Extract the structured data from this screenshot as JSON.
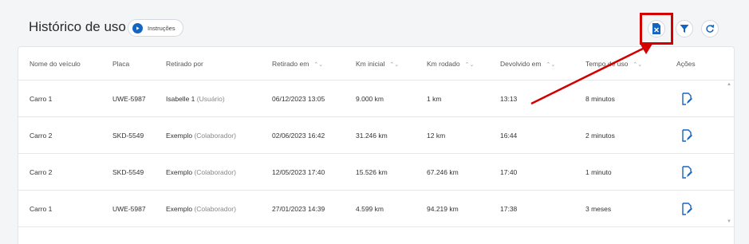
{
  "header": {
    "title": "Histórico de uso",
    "instructions_label": "Instruções"
  },
  "toolbar": {
    "export_icon": "spreadsheet-export-icon",
    "filter_icon": "filter-icon",
    "refresh_icon": "refresh-icon"
  },
  "table": {
    "columns": [
      {
        "label": "Nome do veículo",
        "sortable": false
      },
      {
        "label": "Placa",
        "sortable": false
      },
      {
        "label": "Retirado por",
        "sortable": false
      },
      {
        "label": "Retirado em",
        "sortable": true
      },
      {
        "label": "Km inicial",
        "sortable": true
      },
      {
        "label": "Km rodado",
        "sortable": true
      },
      {
        "label": "Devolvido em",
        "sortable": true
      },
      {
        "label": "Tempo de uso",
        "sortable": true
      },
      {
        "label": "Ações",
        "sortable": false
      }
    ],
    "rows": [
      {
        "vehicle": "Carro 1",
        "plate": "UWE-5987",
        "user": "Isabelle 1",
        "role": "(Usuário)",
        "taken_at": "06/12/2023 13:05",
        "km_start": "9.000 km",
        "km_driven": "1 km",
        "returned_at": "13:13",
        "duration": "8 minutos"
      },
      {
        "vehicle": "Carro 2",
        "plate": "SKD-5549",
        "user": "Exemplo",
        "role": "(Colaborador)",
        "taken_at": "02/06/2023 16:42",
        "km_start": "31.246 km",
        "km_driven": "12 km",
        "returned_at": "16:44",
        "duration": "2 minutos"
      },
      {
        "vehicle": "Carro 2",
        "plate": "SKD-5549",
        "user": "Exemplo",
        "role": "(Colaborador)",
        "taken_at": "12/05/2023 17:40",
        "km_start": "15.526 km",
        "km_driven": "67.246 km",
        "returned_at": "17:40",
        "duration": "1 minuto"
      },
      {
        "vehicle": "Carro 1",
        "plate": "UWE-5987",
        "user": "Exemplo",
        "role": "(Colaborador)",
        "taken_at": "27/01/2023 14:39",
        "km_start": "4.599 km",
        "km_driven": "94.219 km",
        "returned_at": "17:38",
        "duration": "3 meses"
      }
    ]
  },
  "colors": {
    "accent": "#1565c0",
    "annotation": "#d40000"
  }
}
